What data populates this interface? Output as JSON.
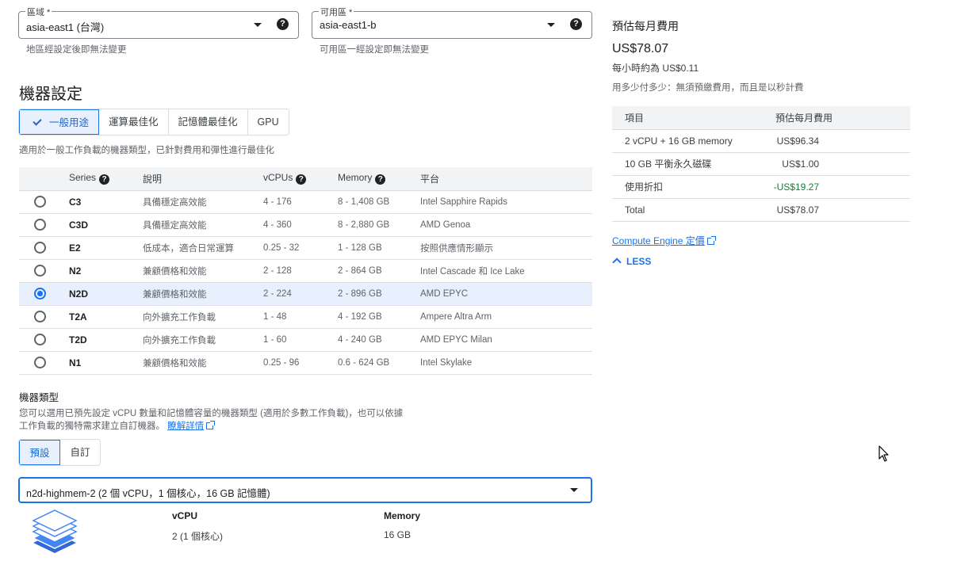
{
  "region": {
    "label": "區域 *",
    "value": "asia-east1 (台灣)",
    "hint": "地區經設定後即無法變更"
  },
  "zone": {
    "label": "可用區 *",
    "value": "asia-east1-b",
    "hint": "可用區一經設定即無法變更"
  },
  "help_glyph": "?",
  "machine_config": {
    "title": "機器設定",
    "families": [
      {
        "label": "一般用途",
        "active": true
      },
      {
        "label": "運算最佳化",
        "active": false
      },
      {
        "label": "記憶體最佳化",
        "active": false
      },
      {
        "label": "GPU",
        "active": false
      }
    ],
    "family_desc": "適用於一般工作負載的機器類型，已針對費用和彈性進行最佳化",
    "columns": {
      "series": "Series",
      "desc": "說明",
      "vcpus": "vCPUs",
      "memory": "Memory",
      "platform": "平台"
    },
    "rows": [
      {
        "name": "C3",
        "desc": "具備穩定高效能",
        "vcpus": "4 - 176",
        "memory": "8 - 1,408 GB",
        "platform": "Intel Sapphire Rapids",
        "selected": false
      },
      {
        "name": "C3D",
        "desc": "具備穩定高效能",
        "vcpus": "4 - 360",
        "memory": "8 - 2,880 GB",
        "platform": "AMD Genoa",
        "selected": false
      },
      {
        "name": "E2",
        "desc": "低成本，適合日常運算",
        "vcpus": "0.25 - 32",
        "memory": "1 - 128 GB",
        "platform": "按照供應情形顯示",
        "selected": false
      },
      {
        "name": "N2",
        "desc": "兼顧價格和效能",
        "vcpus": "2 - 128",
        "memory": "2 - 864 GB",
        "platform": "Intel Cascade 和 Ice Lake",
        "selected": false
      },
      {
        "name": "N2D",
        "desc": "兼顧價格和效能",
        "vcpus": "2 - 224",
        "memory": "2 - 896 GB",
        "platform": "AMD EPYC",
        "selected": true
      },
      {
        "name": "T2A",
        "desc": "向外擴充工作負載",
        "vcpus": "1 - 48",
        "memory": "4 - 192 GB",
        "platform": "Ampere Altra Arm",
        "selected": false
      },
      {
        "name": "T2D",
        "desc": "向外擴充工作負載",
        "vcpus": "1 - 60",
        "memory": "4 - 240 GB",
        "platform": "AMD EPYC Milan",
        "selected": false
      },
      {
        "name": "N1",
        "desc": "兼顧價格和效能",
        "vcpus": "0.25 - 96",
        "memory": "0.6 - 624 GB",
        "platform": "Intel Skylake",
        "selected": false
      }
    ]
  },
  "machine_type": {
    "title": "機器類型",
    "desc_line1": "您可以選用已預先設定 vCPU 數量和記憶體容量的機器類型 (適用於多數工作負載)，也可以依據",
    "desc_line2": "工作負載的獨特需求建立自訂機器。",
    "learn_more": "瞭解詳情",
    "tabs": [
      {
        "label": "預設",
        "active": true
      },
      {
        "label": "自訂",
        "active": false
      }
    ],
    "selected": "n2d-highmem-2 (2 個 vCPU，1 個核心，16 GB 記憶體)",
    "specs": {
      "vcpu_label": "vCPU",
      "vcpu_value": "2 (1 個核心)",
      "memory_label": "Memory",
      "memory_value": "16 GB"
    }
  },
  "estimate": {
    "title": "預估每月費用",
    "price": "US$78.07",
    "hourly": "每小時約為 US$0.11",
    "note": "用多少付多少：無須預繳費用，而且是以秒計費",
    "table_header": {
      "item": "項目",
      "cost": "預估每月費用"
    },
    "rows": [
      {
        "item": "2 vCPU + 16 GB memory",
        "cost": "US$96.34"
      },
      {
        "item": "10 GB 平衡永久磁碟",
        "cost": "US$1.00"
      },
      {
        "item": "使用折扣",
        "cost": "-US$19.27"
      },
      {
        "item": "Total",
        "cost": "US$78.07"
      }
    ],
    "pricing_link": "Compute Engine 定價",
    "less": "LESS"
  }
}
